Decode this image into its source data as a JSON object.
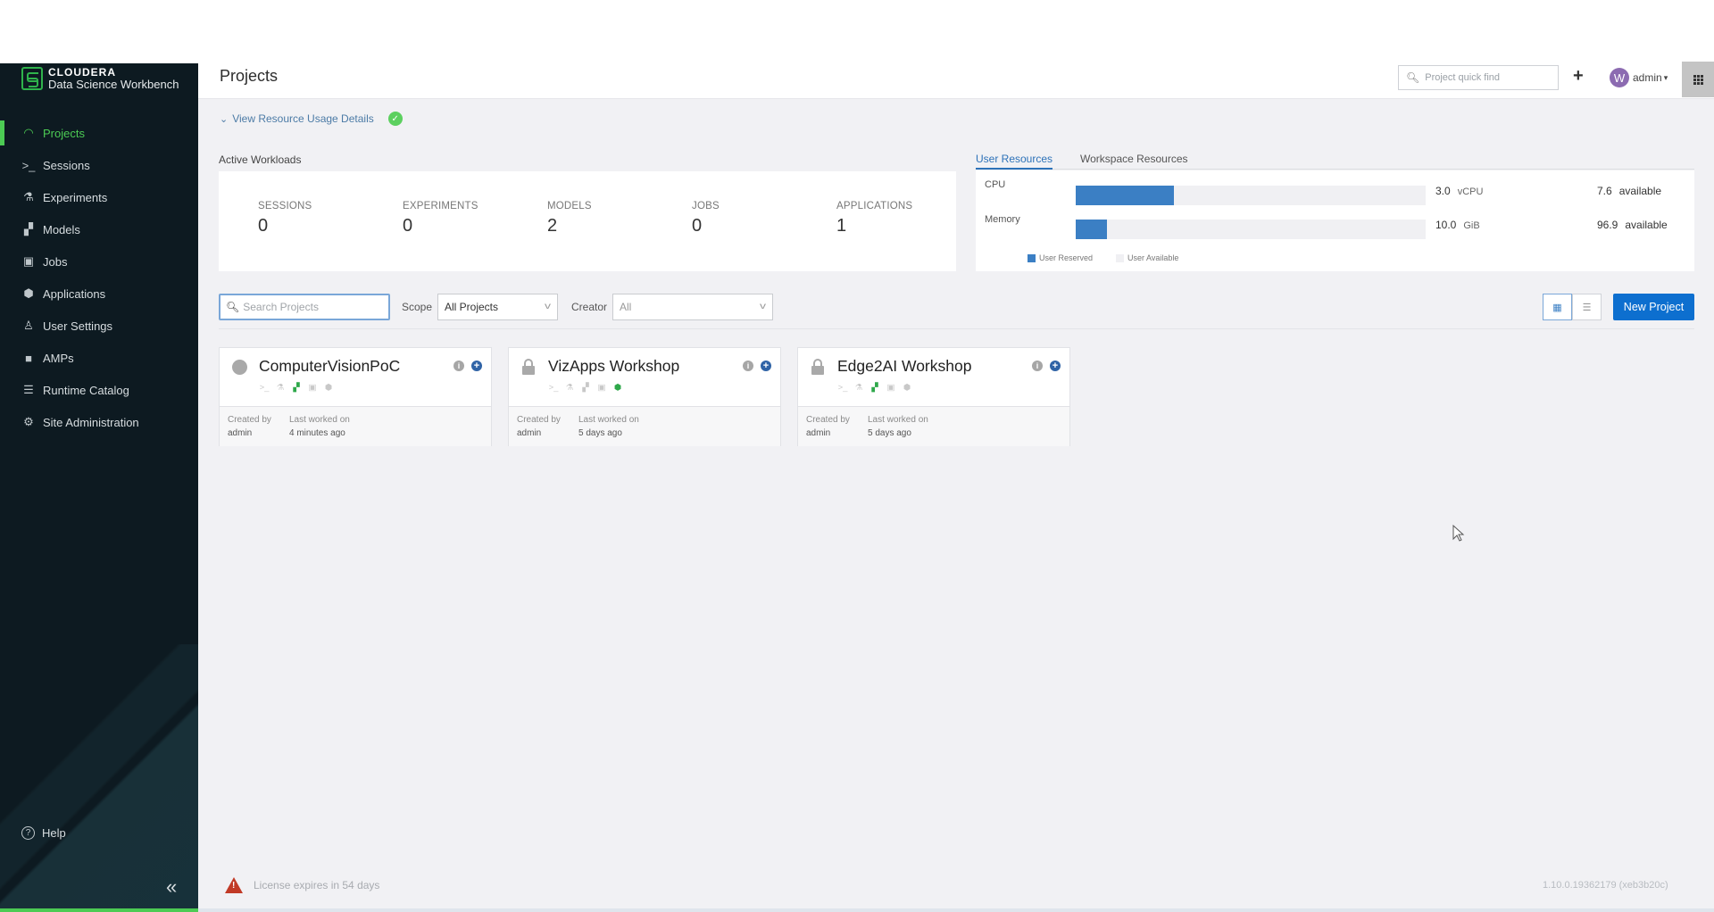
{
  "brand": {
    "name": "CLOUDERA",
    "product": "Data Science Workbench",
    "accent_color": "#4ccb54"
  },
  "sidebar": {
    "items": [
      {
        "label": "Projects",
        "icon": "gauge-icon",
        "active": true
      },
      {
        "label": "Sessions",
        "icon": "terminal-icon",
        "active": false
      },
      {
        "label": "Experiments",
        "icon": "flask-icon",
        "active": false
      },
      {
        "label": "Models",
        "icon": "models-icon",
        "active": false
      },
      {
        "label": "Jobs",
        "icon": "briefcase-icon",
        "active": false
      },
      {
        "label": "Applications",
        "icon": "applications-icon",
        "active": false
      },
      {
        "label": "User Settings",
        "icon": "user-icon",
        "active": false
      },
      {
        "label": "AMPs",
        "icon": "bag-icon",
        "active": false
      },
      {
        "label": "Runtime Catalog",
        "icon": "list-icon",
        "active": false
      },
      {
        "label": "Site Administration",
        "icon": "gear-icon",
        "active": false
      }
    ],
    "help_label": "Help",
    "collapse_glyph": "«"
  },
  "header": {
    "title": "Projects",
    "quickfind_placeholder": "Project quick find",
    "add_glyph": "+",
    "user": {
      "initial": "W",
      "name": "admin",
      "caret": "▾",
      "avatar_color": "#8c6bb1"
    }
  },
  "resource_usage": {
    "toggle_label": "View Resource Usage Details",
    "toggle_glyph": "⌄",
    "status_glyph": "✓"
  },
  "active_workloads": {
    "title": "Active Workloads",
    "stats": [
      {
        "label": "SESSIONS",
        "value": "0"
      },
      {
        "label": "EXPERIMENTS",
        "value": "0"
      },
      {
        "label": "MODELS",
        "value": "2"
      },
      {
        "label": "JOBS",
        "value": "0"
      },
      {
        "label": "APPLICATIONS",
        "value": "1"
      }
    ]
  },
  "resources": {
    "tabs": [
      {
        "label": "User Resources",
        "active": true
      },
      {
        "label": "Workspace Resources",
        "active": false
      }
    ],
    "rows": [
      {
        "label": "CPU",
        "value": "3.0",
        "unit": "vCPU",
        "available": "7.6",
        "available_label": "available",
        "reserved_fraction": 0.28
      },
      {
        "label": "Memory",
        "value": "10.0",
        "unit": "GiB",
        "available": "96.9",
        "available_label": "available",
        "reserved_fraction": 0.09
      }
    ],
    "legend": [
      {
        "label": "User Reserved",
        "color": "#3b7fc4"
      },
      {
        "label": "User Available",
        "color": "#f0f0f3"
      }
    ]
  },
  "filters": {
    "search_placeholder": "Search Projects",
    "scope_label": "Scope",
    "scope_value": "All Projects",
    "creator_label": "Creator",
    "creator_value": "All",
    "new_project_label": "New Project"
  },
  "projects": [
    {
      "name": "ComputerVisionPoC",
      "visibility": "public",
      "created_by_label": "Created by",
      "created_by": "admin",
      "last_worked_label": "Last worked on",
      "last_worked": "4 minutes ago",
      "active_icons": [
        "models"
      ]
    },
    {
      "name": "VizApps Workshop",
      "visibility": "private",
      "created_by_label": "Created by",
      "created_by": "admin",
      "last_worked_label": "Last worked on",
      "last_worked": "5 days ago",
      "active_icons": [
        "applications"
      ]
    },
    {
      "name": "Edge2AI Workshop",
      "visibility": "private",
      "created_by_label": "Created by",
      "created_by": "admin",
      "last_worked_label": "Last worked on",
      "last_worked": "5 days ago",
      "active_icons": [
        "models"
      ]
    }
  ],
  "footer": {
    "license_warning": "License expires in 54 days",
    "version": "1.10.0.19362179 (xeb3b20c)"
  }
}
